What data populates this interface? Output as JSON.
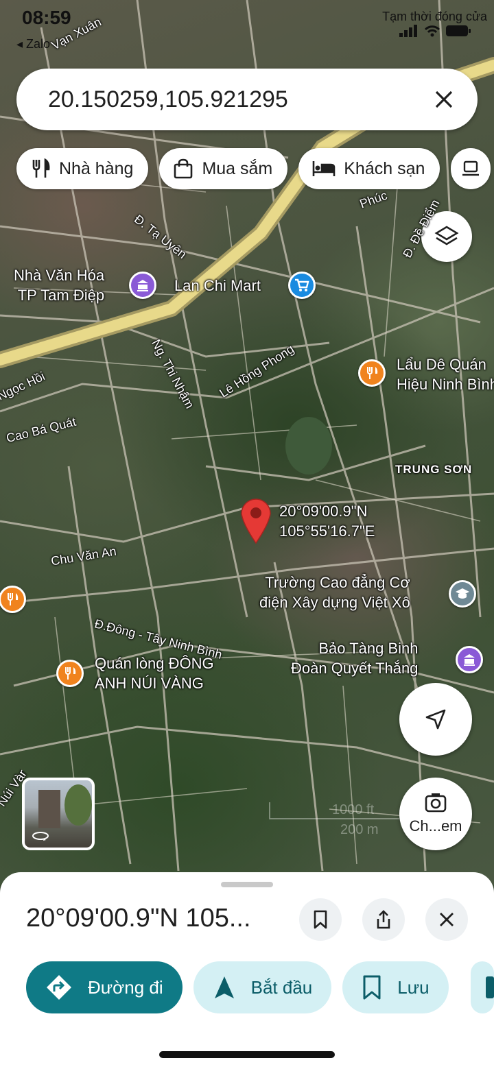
{
  "status_bar": {
    "time": "08:59",
    "back_app": "◂ Zalo",
    "right_text": "Tạm thời đóng cửa"
  },
  "search": {
    "value": "20.150259,105.921295"
  },
  "chips": [
    {
      "label": "Nhà hàng",
      "icon": "fork-knife-icon"
    },
    {
      "label": "Mua sắm",
      "icon": "shopping-bag-icon"
    },
    {
      "label": "Khách sạn",
      "icon": "bed-icon"
    }
  ],
  "map": {
    "streets": {
      "van_xuan": "Vạn Xuân",
      "ta_uyen": "Đ. Tạ Uyên",
      "thi_nham": "Ng. Thi Nhậm",
      "le_hong_phong": "Lê Hồng Phong",
      "ngoc_hoi": "Ngọc Hồi",
      "cao_ba_quat": "Cao Bá Quát",
      "chu_van_an": "Chu Văn An",
      "dong_tay": "Đ.Đông - Tây Ninh Bình",
      "phuc": "Phúc",
      "de_diem": "Đ. Đề Điểm",
      "nui": "Núi Vàng"
    },
    "places": {
      "nha_van_hoa": {
        "line1": "Nhà Văn Hóa",
        "line2": "TP Tam Điệp"
      },
      "lan_chi": "Lan Chi Mart",
      "lau_de": {
        "line1": "Lẩu Dê Quán",
        "line2": "Hiệu Ninh Bình"
      },
      "trung_son": "TRUNG SƠN",
      "truong": {
        "line1": "Trường Cao đẳng Cơ",
        "line2": "điện Xây dựng Việt Xô"
      },
      "bao_tang": {
        "line1": "Bảo Tàng Binh",
        "line2": "Đoàn Quyết Thắng"
      },
      "quan_long": {
        "line1": "Quán lòng ĐÔNG",
        "line2": "ANH NÚI VÀNG"
      }
    },
    "pin": {
      "lat": "20°09'00.9\"N",
      "lng": "105°55'16.7\"E"
    },
    "scale": {
      "ft": "1000 ft",
      "m": "200 m"
    },
    "camera_label": "Ch...em"
  },
  "sheet": {
    "title": "20°09'00.9\"N 105...",
    "actions": {
      "directions": "Đường đi",
      "start": "Bắt đầu",
      "save": "Lưu"
    }
  },
  "colors": {
    "accent": "#0f7a86",
    "accent_soft": "#d4f0f4",
    "pin": "#e53935"
  }
}
